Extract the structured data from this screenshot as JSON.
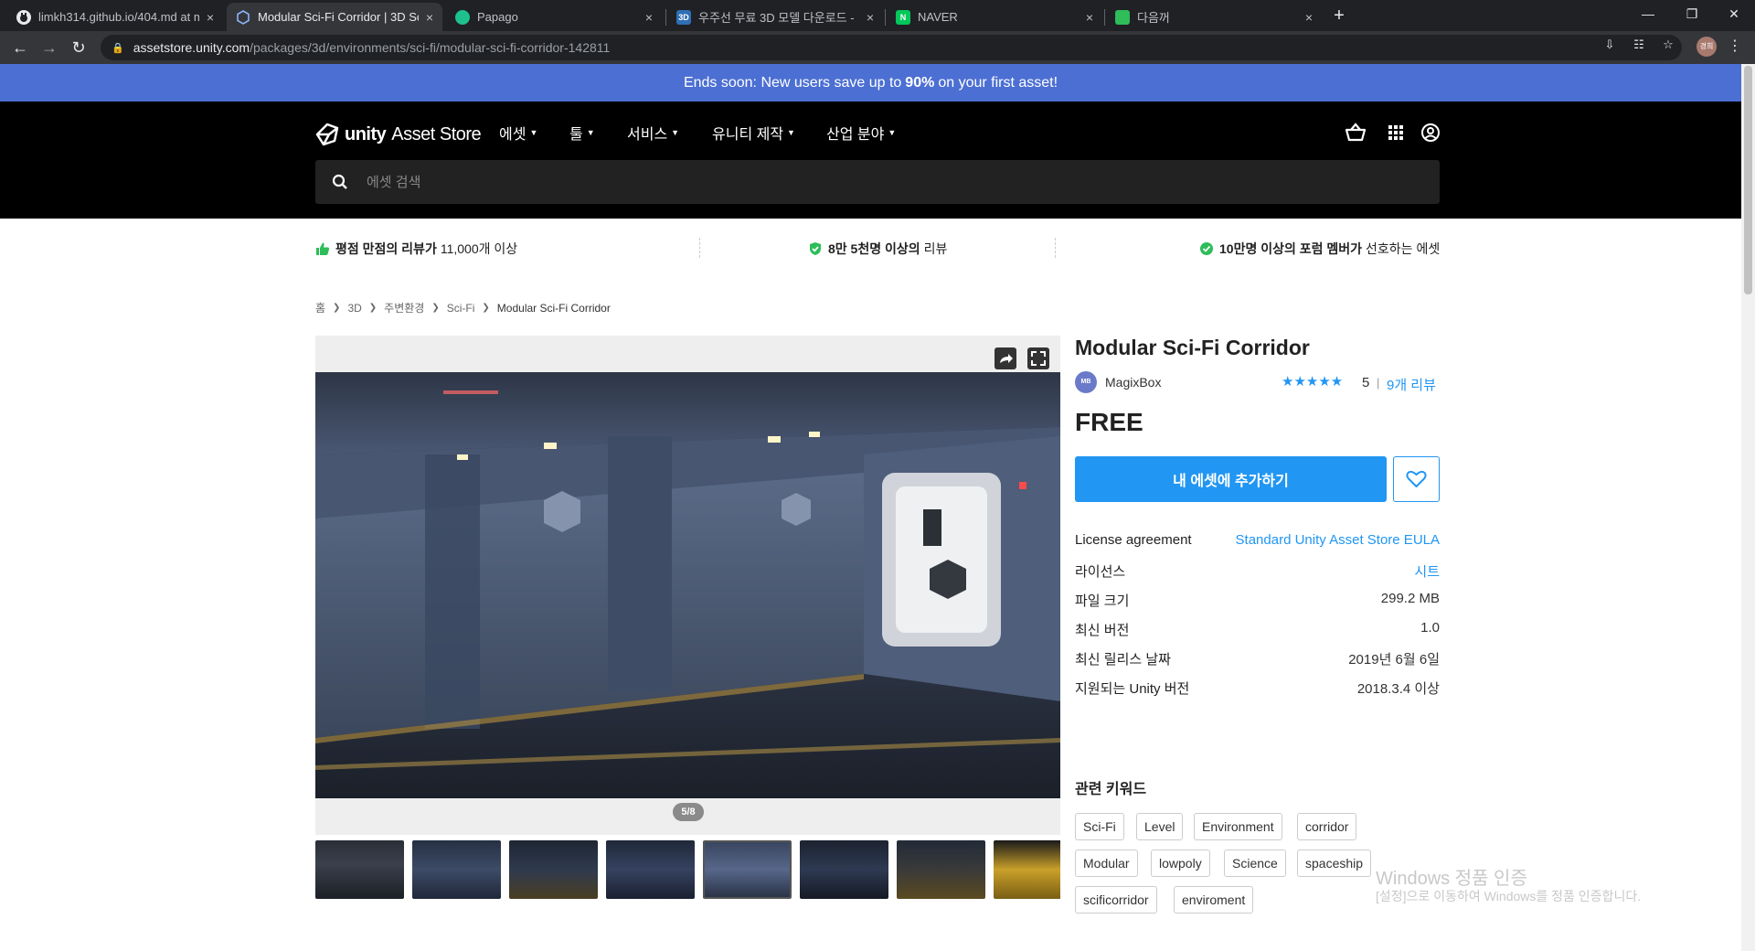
{
  "browser": {
    "tabs": [
      {
        "title": "limkh314.github.io/404.md at m",
        "close": "×"
      },
      {
        "title": "Modular Sci-Fi Corridor | 3D Sci",
        "close": "×"
      },
      {
        "title": "Papago",
        "close": "×"
      },
      {
        "title": "우주선 무료 3D 모델 다운로드 -",
        "close": "×"
      },
      {
        "title": "NAVER",
        "close": "×"
      },
      {
        "title": "다음꺼",
        "close": "×"
      }
    ],
    "tab_favicons": {
      "three_d": "3D",
      "naver": "N"
    },
    "new_tab": "+",
    "url_host": "assetstore.unity.com",
    "url_path": "/packages/3d/environments/sci-fi/modular-sci-fi-corridor-142811",
    "profile_initials": "경희"
  },
  "promo": {
    "prefix": "Ends soon: New users save up to",
    "highlight": "90%",
    "suffix": "on your first asset!"
  },
  "header": {
    "logo_bold": "unity",
    "logo_rest": "Asset Store",
    "nav": [
      "에셋",
      "툴",
      "서비스",
      "유니티 제작",
      "산업 분야"
    ],
    "search_placeholder": "에셋 검색"
  },
  "trust": [
    {
      "bold": "평점 만점의 리뷰가",
      "rest": "11,000개 이상"
    },
    {
      "bold": "8만 5천명 이상의",
      "rest": "리뷰"
    },
    {
      "bold": "10만명 이상의 포럼 멤버가",
      "rest": "선호하는 에셋"
    }
  ],
  "breadcrumb": [
    "홈",
    "3D",
    "주변환경",
    "Sci-Fi",
    "Modular Sci-Fi Corridor"
  ],
  "gallery": {
    "counter": "5/8"
  },
  "product": {
    "title": "Modular Sci-Fi Corridor",
    "publisher": "MagixBox",
    "publisher_badge": "MB",
    "stars": "★★★★★",
    "rating": "5",
    "rating_sep": "|",
    "reviews": "9개 리뷰",
    "price": "FREE",
    "add_button": "내 에셋에 추가하기",
    "details": [
      {
        "label": "License agreement",
        "value": "Standard Unity Asset Store EULA",
        "link": true
      },
      {
        "label": "라이선스",
        "value": "시트",
        "link": true
      },
      {
        "label": "파일 크기",
        "value": "299.2 MB",
        "link": false
      },
      {
        "label": "최신 버전",
        "value": "1.0",
        "link": false
      },
      {
        "label": "최신 릴리스 날짜",
        "value": "2019년 6월 6일",
        "link": false
      },
      {
        "label": "지원되는 Unity 버전",
        "value": "2018.3.4 이상",
        "link": false
      }
    ],
    "keywords_title": "관련 키워드",
    "keywords": [
      "Sci-Fi",
      "Level",
      "Environment",
      "corridor",
      "Modular",
      "lowpoly",
      "Science",
      "spaceship",
      "scificorridor",
      "enviroment"
    ]
  },
  "watermark": {
    "line1": "Windows 정품 인증",
    "line2": "[설정]으로 이동하여 Windows를 정품 인증합니다."
  },
  "colors": {
    "promo": "#4c6fd3",
    "accent": "#2196f3",
    "check": "#2ebd59"
  }
}
